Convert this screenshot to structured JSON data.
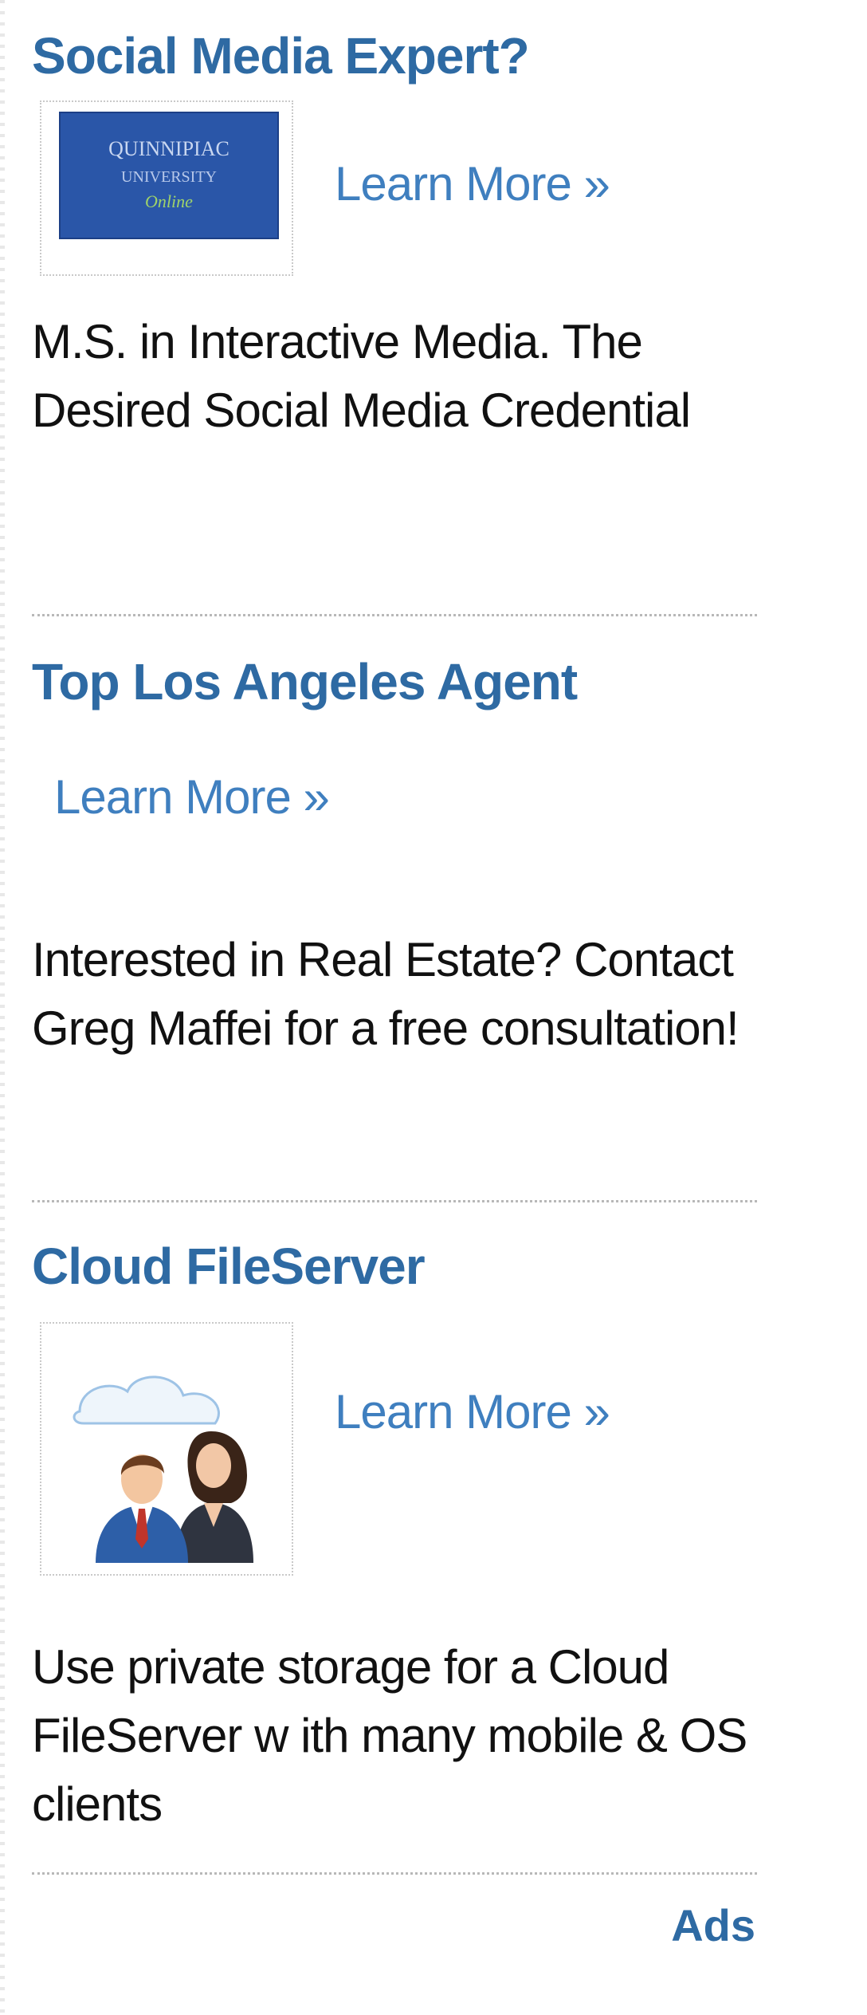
{
  "ads": [
    {
      "title": "Social Media Expert?",
      "logo_text": [
        "QUINNIPIAC",
        "UNIVERSITY",
        "Online"
      ],
      "learn_more": "Learn More »",
      "description": "M.S. in Interactive Media. The Desired Social Media Credential"
    },
    {
      "title": "Top Los Angeles Agent",
      "learn_more": "Learn More »",
      "description": "Interested in Real Estate? Contact Greg Maffei for a free consultation!"
    },
    {
      "title": "Cloud FileServer",
      "learn_more": "Learn More »",
      "description": "Use private storage for a Cloud FileServer w ith many mobile & OS clients"
    }
  ],
  "footer": {
    "ads_label": "Ads"
  },
  "colors": {
    "title": "#2e6aa3",
    "link": "#3f7fbf",
    "text": "#111111",
    "logo_bg": "#2a56a8"
  }
}
